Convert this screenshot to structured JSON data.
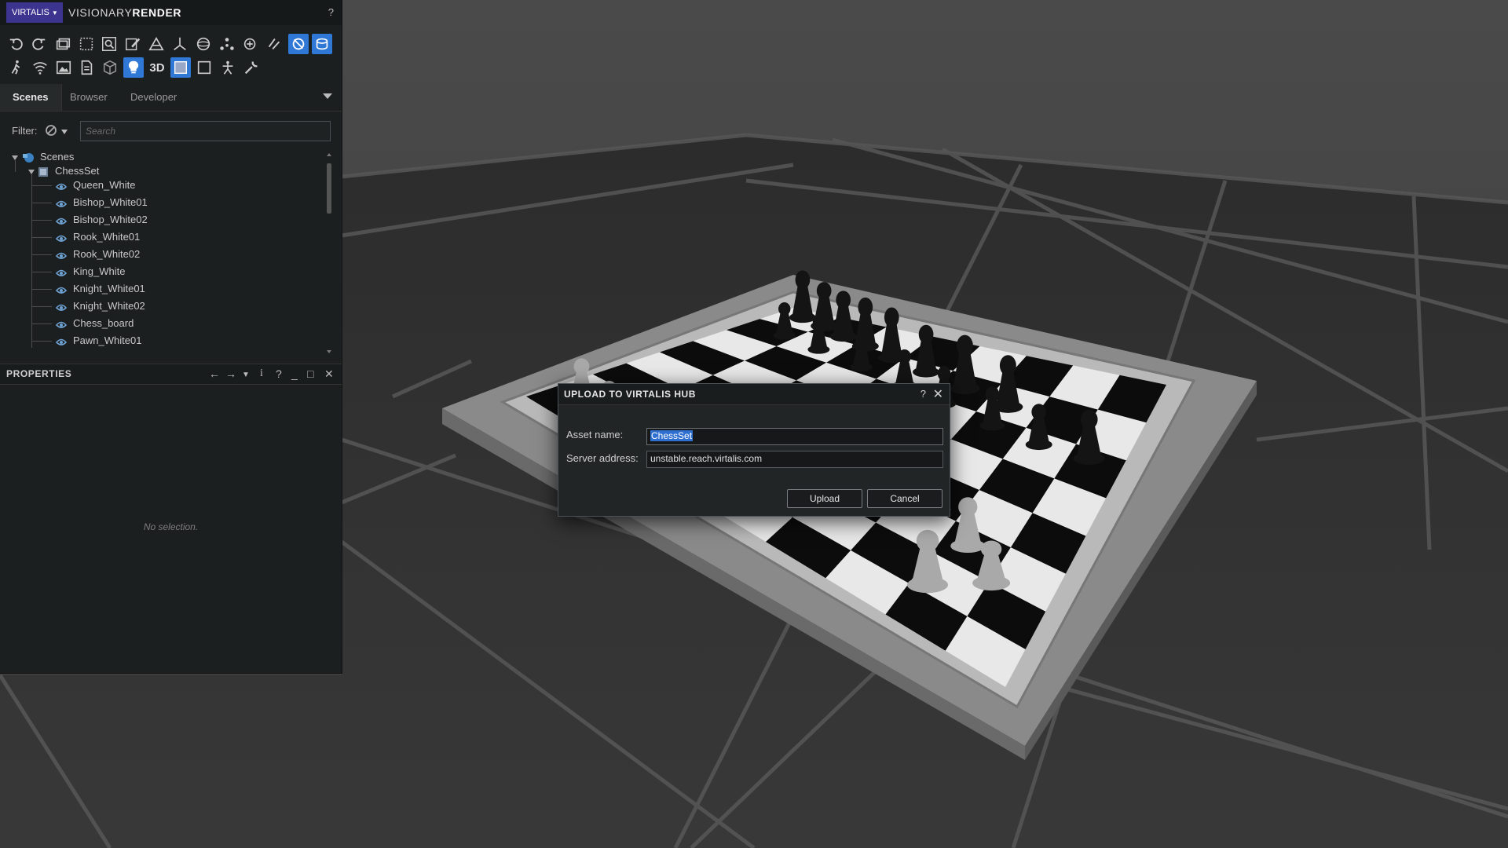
{
  "app": {
    "brand": "VIRTALIS",
    "name_light": "VISIONARY",
    "name_bold": "RENDER",
    "help": "?"
  },
  "toolbar": {
    "mode_3d_label": "3D"
  },
  "tabs": [
    {
      "label": "Scenes",
      "active": true
    },
    {
      "label": "Browser",
      "active": false
    },
    {
      "label": "Developer",
      "active": false
    }
  ],
  "filter": {
    "label": "Filter:",
    "search_placeholder": "Search"
  },
  "tree": {
    "root": "Scenes",
    "scene": "ChessSet",
    "children": [
      "Queen_White",
      "Bishop_White01",
      "Bishop_White02",
      "Rook_White01",
      "Rook_White02",
      "King_White",
      "Knight_White01",
      "Knight_White02",
      "Chess_board",
      "Pawn_White01"
    ]
  },
  "properties": {
    "title": "PROPERTIES",
    "empty_text": "No selection."
  },
  "dialog": {
    "title": "UPLOAD TO VIRTALIS HUB",
    "help": "?",
    "asset_label": "Asset name:",
    "asset_value": "ChessSet",
    "server_label": "Server address:",
    "server_value": "unstable.reach.virtalis.com",
    "upload_label": "Upload",
    "cancel_label": "Cancel"
  },
  "colors": {
    "brand_bg": "#3d3490",
    "accent": "#2f78d6",
    "panel_bg": "#1c1f20",
    "viewport_bg": "#3f3f3f"
  }
}
